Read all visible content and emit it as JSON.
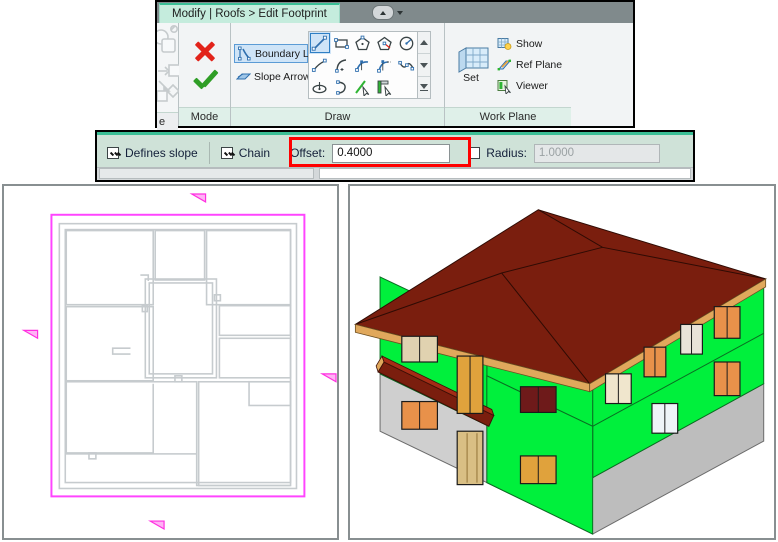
{
  "ribbon": {
    "tab_label": "Modify | Roofs > Edit Footprint",
    "collapse_button_name": "collapse-ribbon",
    "panels": [
      {
        "label": "e"
      },
      {
        "label": "Mode"
      },
      {
        "label": "Draw"
      },
      {
        "label": "Work Plane"
      }
    ],
    "mode_panel": {
      "label": "Mode",
      "cancel_icon": "red-x-icon",
      "finish_icon": "green-check-icon"
    },
    "draw_panel": {
      "label": "Draw",
      "items": [
        {
          "label": "Boundary Line",
          "icon": "boundary-line-icon",
          "selected": true
        },
        {
          "label": "Slope Arrow",
          "icon": "slope-arrow-icon",
          "selected": false
        }
      ],
      "gallery_icons": [
        "line-tool-icon",
        "rectangle-tool-icon",
        "inscribed-polygon-icon",
        "circumscribed-polygon-icon",
        "circle-tool-icon",
        "start-end-radius-arc-icon",
        "center-ends-arc-icon",
        "tangent-end-arc-icon",
        "fillet-arc-icon",
        "spline-tool-icon",
        "ellipse-tool-icon",
        "partial-ellipse-icon",
        "pick-lines-icon",
        "pick-walls-icon"
      ],
      "gallery_selected_index": 0,
      "scroll_up_icon": "scroll-up-icon",
      "scroll_down_icon": "scroll-down-icon",
      "scroll_expand_icon": "expand-gallery-icon"
    },
    "work_plane_panel": {
      "label": "Work Plane",
      "set_label": "Set",
      "set_icon": "work-plane-grid-icon",
      "items": [
        {
          "label": "Show",
          "icon": "show-work-plane-icon"
        },
        {
          "label": "Ref  Plane",
          "icon": "reference-plane-icon"
        },
        {
          "label": "Viewer",
          "icon": "work-plane-viewer-icon"
        }
      ]
    }
  },
  "options_bar": {
    "defines_slope": {
      "label": "Defines slope",
      "checked": true
    },
    "chain": {
      "label": "Chain",
      "checked": true
    },
    "offset": {
      "label": "Offset:",
      "value": "0.4000",
      "highlighted": true
    },
    "radius": {
      "label": "Radius:",
      "value": "1.0000",
      "checked": false,
      "disabled": true
    },
    "highlight_color": "#ff0000"
  },
  "views": {
    "plan": {
      "name": "Floor plan view with roof footprint sketch",
      "sketch_line_color": "#ff44ff",
      "wall_line_color": "#c6cbce",
      "slope_arrow_icon": "slope-arrow-marker",
      "slope_arrow_count": 4
    },
    "three_d": {
      "name": "3D axonometric view of building with hip roof",
      "roof_color": "#7a1e0e",
      "wall_color": "#00f03c",
      "foundation_color": "#bdbdbd",
      "fascia_color": "#e0a85c"
    }
  }
}
